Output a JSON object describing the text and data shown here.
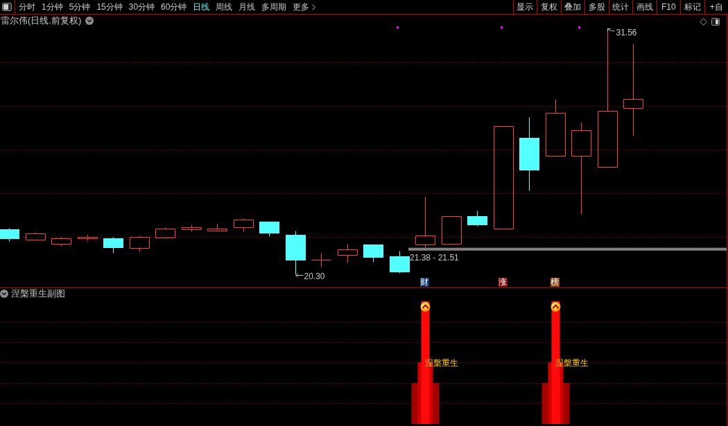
{
  "toolbar": {
    "periods": [
      {
        "label": "分时",
        "selected": false
      },
      {
        "label": "1分钟",
        "selected": false
      },
      {
        "label": "5分钟",
        "selected": false
      },
      {
        "label": "15分钟",
        "selected": false
      },
      {
        "label": "30分钟",
        "selected": false
      },
      {
        "label": "60分钟",
        "selected": false
      },
      {
        "label": "日线",
        "selected": true
      },
      {
        "label": "周线",
        "selected": false
      },
      {
        "label": "月线",
        "selected": false
      },
      {
        "label": "多周期",
        "selected": false
      }
    ],
    "more": "更多",
    "actions": [
      "显示",
      "复权",
      "叠加",
      "多股",
      "统计",
      "画线",
      "F10",
      "标记",
      "+自"
    ]
  },
  "price_pane": {
    "title": "雷尔伟(日线.前复权)",
    "high_label": "31.56",
    "gap_label": "21.38 - 21.51",
    "low_label": "20.30",
    "event_tags": [
      {
        "text": "财",
        "color": "#0d3a6e"
      },
      {
        "text": "涨",
        "color": "#8b0a0a"
      },
      {
        "text": "榜",
        "color": "#8a4a12"
      }
    ]
  },
  "indicator_pane": {
    "title": "涅槃重生副图",
    "signal_labels": [
      "涅槃重生",
      "涅槃重生"
    ]
  }
}
